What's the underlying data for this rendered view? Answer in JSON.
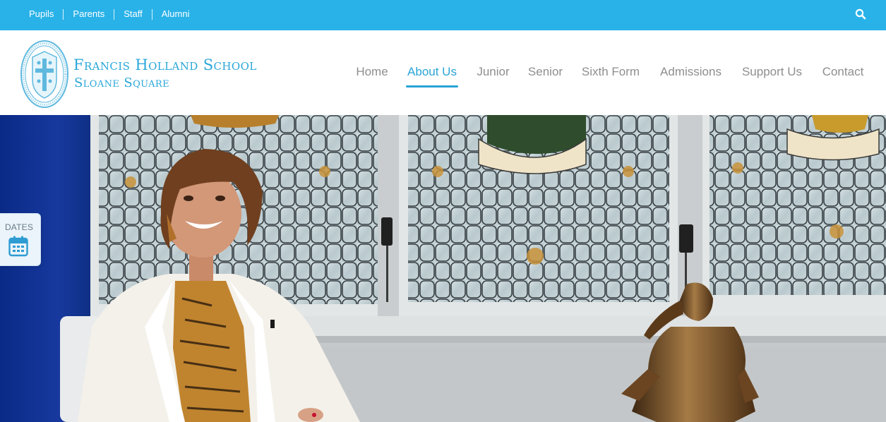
{
  "topbar": {
    "links": [
      "Pupils",
      "Parents",
      "Staff",
      "Alumni"
    ],
    "search_icon": "search-icon",
    "color": "#29b2e8"
  },
  "header": {
    "school_name": "Francis Holland School",
    "school_sub": "Sloane Square",
    "logo_icon": "school-crest-icon",
    "accent": "#2aa7d9"
  },
  "nav": {
    "items": [
      "Home",
      "About Us",
      "Junior",
      "Senior",
      "Sixth Form",
      "Admissions",
      "Support Us",
      "Contact"
    ],
    "active": "About Us"
  },
  "side_tab": {
    "label": "DATES",
    "icon": "calendar-icon"
  }
}
